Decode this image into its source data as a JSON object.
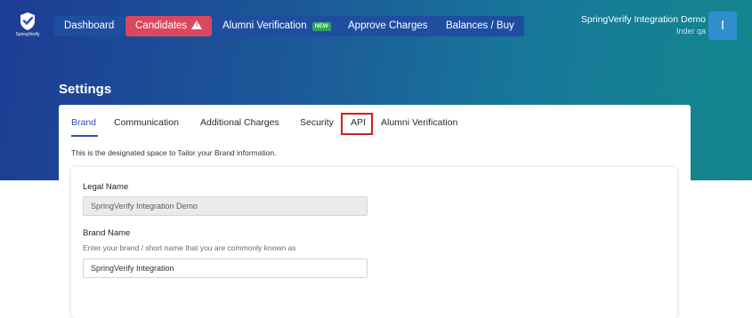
{
  "brand": {
    "logo_text": "SpringVerify"
  },
  "nav": {
    "dashboard": "Dashboard",
    "candidates": "Candidates",
    "alumni": "Alumni Verification",
    "alumni_badge": "NEW",
    "approve": "Approve Charges",
    "balances": "Balances / Buy"
  },
  "user": {
    "org": "SpringVerify Integration Demo",
    "name": "Inder qa",
    "avatar_letter": "I"
  },
  "page": {
    "title": "Settings"
  },
  "tabs": [
    "Brand",
    "Communication",
    "Additional Charges",
    "Security",
    "API",
    "Alumni Verification"
  ],
  "active_tab": "Brand",
  "highlighted_tab": "API",
  "description": "This is the designated space to Tailor your Brand information.",
  "form": {
    "legal_name_label": "Legal Name",
    "legal_name_value": "SpringVerify Integration Demo",
    "brand_name_label": "Brand Name",
    "brand_name_helper": "Enter your brand / short name that you are commonly known as",
    "brand_name_value": "SpringVerify Integration"
  },
  "colors": {
    "header_gradient_start": "#1d3c94",
    "header_gradient_end": "#13878c",
    "nav_button": "#1f4ea1",
    "candidates_button": "#d9485f",
    "active_tab": "#2c4fb8",
    "highlight_border": "#d11f1f"
  }
}
